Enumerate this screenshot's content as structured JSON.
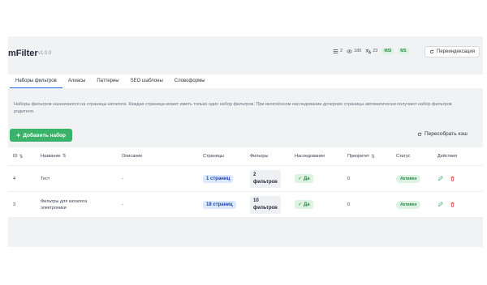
{
  "app": {
    "title": "mFilter",
    "version": "v1.0.0"
  },
  "stats": {
    "sets": "2",
    "views": "180",
    "translations": "23",
    "mysql": "MSI",
    "ms": "MS"
  },
  "reindex_label": "Переиндексация",
  "tabs": [
    "Наборы фильтров",
    "Алиасы",
    "Паттерны",
    "SEO шаблоны",
    "Словоформы"
  ],
  "info": "Наборы фильтров назначаются на страницы каталога. Каждая страница может иметь только один набор фильтров. При включённом наследовании дочерние страницы автоматически получают набор фильтров родителя.",
  "add_label": "Добавить набор",
  "rebuild_label": "Пересобрать кэш",
  "table": {
    "headers": {
      "id": "ID",
      "name": "Название",
      "desc": "Описание",
      "pages": "Страницы",
      "filters": "Фильтры",
      "inherit": "Наследование",
      "priority": "Приоритет",
      "status": "Статус",
      "actions": "Действия"
    },
    "rows": [
      {
        "id": "4",
        "name": "Тест",
        "desc": "-",
        "pages": "1 страниц",
        "filters": "2 фильтров",
        "inherit": "Да",
        "priority": "0",
        "status": "Активен"
      },
      {
        "id": "3",
        "name": "Фильтры для каталога электроники",
        "desc": "-",
        "pages": "18 страниц",
        "filters": "10 фильтров",
        "inherit": "Да",
        "priority": "0",
        "status": "Активен"
      }
    ]
  },
  "colors": {
    "accent": "#3ab26a",
    "tab_active": "#2563eb",
    "danger": "#dc2626"
  }
}
